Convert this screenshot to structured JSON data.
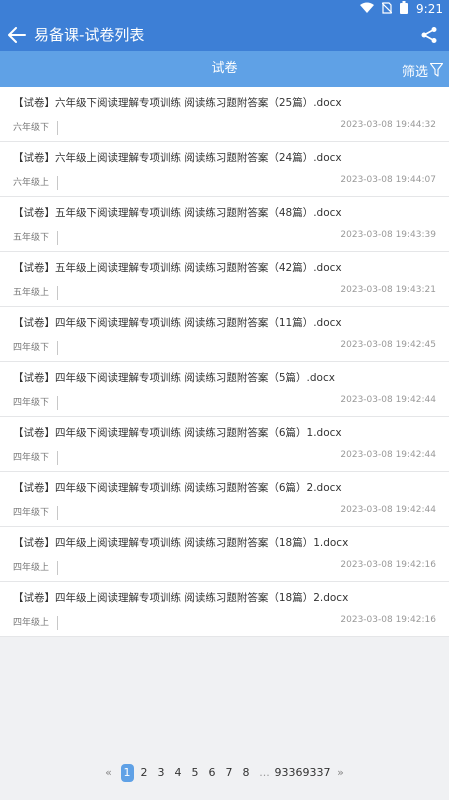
{
  "status": {
    "time": "9:21"
  },
  "appbar": {
    "title": "易备课-试卷列表"
  },
  "tabbar": {
    "tab_label": "试卷",
    "filter_label": "筛选"
  },
  "items": [
    {
      "name": "【试卷】六年级下阅读理解专项训练 阅读练习题附答案（25篇）.docx",
      "grade": "六年级下",
      "time": "2023-03-08 19:44:32"
    },
    {
      "name": "【试卷】六年级上阅读理解专项训练 阅读练习题附答案（24篇）.docx",
      "grade": "六年级上",
      "time": "2023-03-08 19:44:07"
    },
    {
      "name": "【试卷】五年级下阅读理解专项训练 阅读练习题附答案（48篇）.docx",
      "grade": "五年级下",
      "time": "2023-03-08 19:43:39"
    },
    {
      "name": "【试卷】五年级上阅读理解专项训练 阅读练习题附答案（42篇）.docx",
      "grade": "五年级上",
      "time": "2023-03-08 19:43:21"
    },
    {
      "name": "【试卷】四年级下阅读理解专项训练 阅读练习题附答案（11篇）.docx",
      "grade": "四年级下",
      "time": "2023-03-08 19:42:45"
    },
    {
      "name": "【试卷】四年级下阅读理解专项训练 阅读练习题附答案（5篇）.docx",
      "grade": "四年级下",
      "time": "2023-03-08 19:42:44"
    },
    {
      "name": "【试卷】四年级下阅读理解专项训练 阅读练习题附答案（6篇）1.docx",
      "grade": "四年级下",
      "time": "2023-03-08 19:42:44"
    },
    {
      "name": "【试卷】四年级下阅读理解专项训练 阅读练习题附答案（6篇）2.docx",
      "grade": "四年级下",
      "time": "2023-03-08 19:42:44"
    },
    {
      "name": "【试卷】四年级上阅读理解专项训练 阅读练习题附答案（18篇）1.docx",
      "grade": "四年级上",
      "time": "2023-03-08 19:42:16"
    },
    {
      "name": "【试卷】四年级上阅读理解专项训练 阅读练习题附答案（18篇）2.docx",
      "grade": "四年级上",
      "time": "2023-03-08 19:42:16"
    }
  ],
  "pager": {
    "prev": "«",
    "pages": [
      "1",
      "2",
      "3",
      "4",
      "5",
      "6",
      "7",
      "8"
    ],
    "current": "1",
    "ellipsis": "...",
    "tail": [
      "9336",
      "9337"
    ],
    "next": "»"
  },
  "colors": {
    "primary": "#3d7fd6",
    "tab": "#5fa1e6"
  }
}
